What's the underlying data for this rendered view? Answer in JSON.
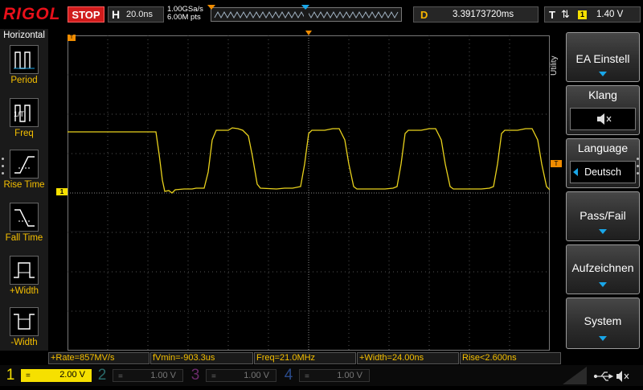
{
  "header": {
    "brand": "RIGOL",
    "run_state": "STOP",
    "timebase_key": "H",
    "timebase_value": "20.0ns",
    "sample_rate": "1.00GSa/s",
    "memory_depth": "6.00M pts",
    "delay_key": "D",
    "delay_value": "3.39173720ms",
    "trigger_key": "T",
    "trigger_edge_icon": "rising-falling-edge-icon",
    "trigger_source": "1",
    "trigger_level": "1.40 V"
  },
  "left_panel": {
    "title": "Horizontal",
    "items": [
      {
        "label": "Period",
        "icon": "period-icon"
      },
      {
        "label": "Freq",
        "icon": "frequency-icon"
      },
      {
        "label": "Rise Time",
        "icon": "rise-time-icon"
      },
      {
        "label": "Fall Time",
        "icon": "fall-time-icon"
      },
      {
        "label": "+Width",
        "icon": "positive-width-icon"
      },
      {
        "label": "-Width",
        "icon": "negative-width-icon"
      }
    ]
  },
  "right_menu": {
    "tab_label": "Utility",
    "items": [
      {
        "label": "EA Einstell"
      },
      {
        "label": "Klang",
        "value_icon": "speaker-muted-icon"
      },
      {
        "label": "Language",
        "value": "Deutsch"
      },
      {
        "label": "Pass/Fail"
      },
      {
        "label": "Aufzeichnen"
      },
      {
        "label": "System"
      }
    ]
  },
  "measurements": [
    "+Rate=857MV/s",
    "fVmin=-903.3us",
    "Freq=21.0MHz",
    "+Width=24.00ns",
    "Rise<2.600ns"
  ],
  "channels": [
    {
      "number": "1",
      "coupling": "=",
      "scale": "2.00 V",
      "active": true
    },
    {
      "number": "2",
      "coupling": "=",
      "scale": "1.00 V",
      "active": false
    },
    {
      "number": "3",
      "coupling": "=",
      "scale": "1.00 V",
      "active": false
    },
    {
      "number": "4",
      "coupling": "=",
      "scale": "1.00 V",
      "active": false
    }
  ],
  "status_icons": [
    "usb-icon",
    "speaker-muted-icon"
  ],
  "colors": {
    "ch1": "#f6e000",
    "ch2": "#19c8c8",
    "ch3": "#d23cd2",
    "ch4": "#2f6fe0",
    "trigger": "#f08c00",
    "accent_blue": "#19a6e8",
    "brand_red": "#e8101a"
  }
}
